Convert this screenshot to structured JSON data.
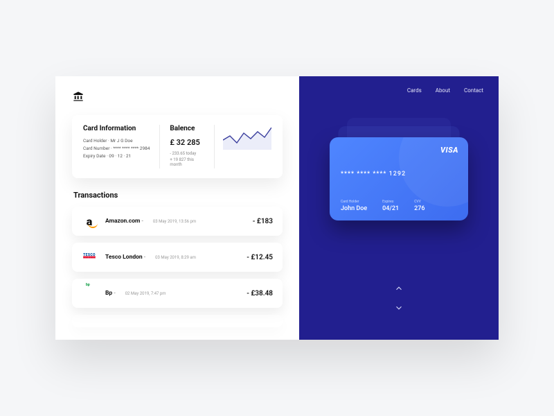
{
  "nav": {
    "cards": "Cards",
    "about": "About",
    "contact": "Contact"
  },
  "info": {
    "title": "Card Information",
    "holder_label": "Card Holder",
    "holder_value": "Mr J G Doe",
    "number_label": "Card Number",
    "number_value": "**** **** **** 2984",
    "expiry_label": "Expiry Date",
    "expiry_value": "09 · 12 · 21"
  },
  "balance": {
    "title": "Balence",
    "amount": "£ 32 285",
    "today": "- 233.65 today",
    "month": "+ 19 827 this month"
  },
  "transactions": {
    "title": "Transactions",
    "items": [
      {
        "merchant": "Amazon.com",
        "date": "03 May 2019, 13:56 pm",
        "amount": "- £183"
      },
      {
        "merchant": "Tesco London",
        "date": "03 May 2019, 8:29  am",
        "amount": "- £12.45"
      },
      {
        "merchant": "Bp",
        "date": "02 May 2019, 7:47 pm",
        "amount": "- £38.48"
      }
    ]
  },
  "card": {
    "brand": "VISA",
    "number": "**** **** **** 1292",
    "holder_label": "Card Holder",
    "holder": "John Doe",
    "expiry_label": "Expires",
    "expiry": "04/21",
    "cvv_label": "CVV",
    "cvv": "276"
  },
  "chart_data": {
    "type": "line",
    "title": "",
    "xlabel": "",
    "ylabel": "",
    "x": [
      0,
      1,
      2,
      3,
      4,
      5,
      6,
      7
    ],
    "values": [
      18,
      24,
      14,
      28,
      20,
      30,
      22,
      34
    ],
    "ylim": [
      10,
      40
    ]
  }
}
